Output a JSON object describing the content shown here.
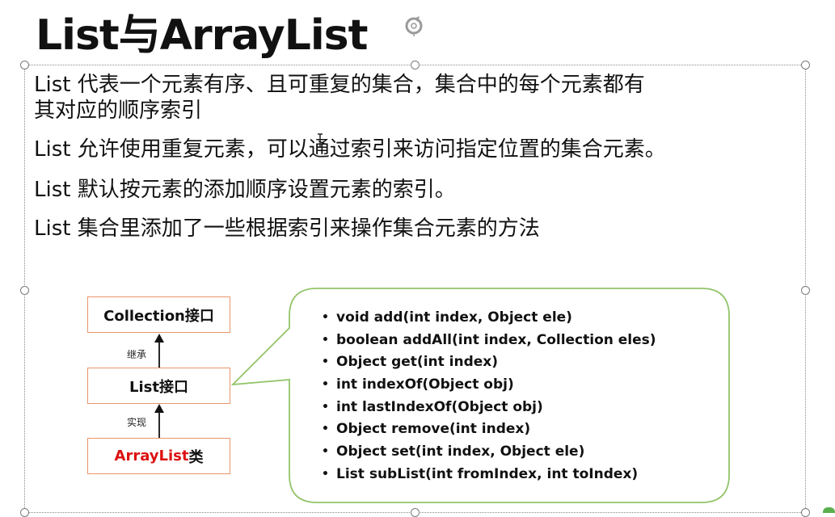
{
  "slide": {
    "title": "List与ArrayList",
    "paragraphs": [
      "List 代表一个元素有序、且可重复的集合，集合中的每个元素都有",
      "其对应的顺序索引",
      "List 允许使用重复元素，可以通过索引来访问指定位置的集合元素。",
      "List 默认按元素的添加顺序设置元素的索引。",
      "List 集合里添加了一些根据索引来操作集合元素的方法"
    ]
  },
  "diagram": {
    "boxes": {
      "collection": "Collection接口",
      "list": "List接口",
      "arraylist_main": "ArrayList",
      "arraylist_suffix": "类"
    },
    "arrows": {
      "inherit": "继承",
      "implement": "实现"
    },
    "methods": [
      "void add(int index, Object ele)",
      "boolean addAll(int index, Collection eles)",
      "Object get(int index)",
      "int indexOf(Object obj)",
      "int lastIndexOf(Object obj)",
      "Object remove(int index)",
      "Object set(int index, Object ele)",
      "List subList(int fromIndex, int toIndex)"
    ],
    "bullet": "•"
  },
  "colors": {
    "box_border": "#e8956b",
    "arraylist_text": "#d11111",
    "callout_border": "#92c46a",
    "selection_border": "#8a8a8a"
  }
}
